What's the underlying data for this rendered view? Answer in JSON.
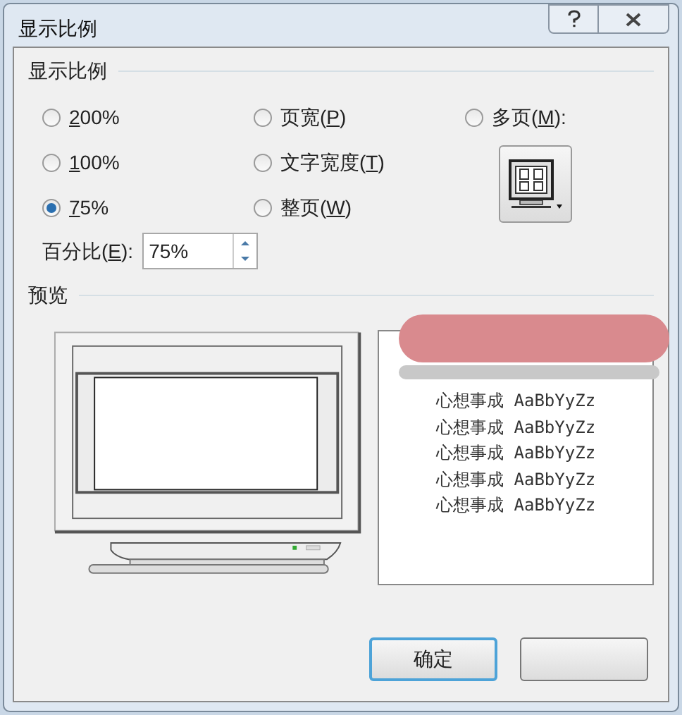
{
  "window": {
    "title": "显示比例"
  },
  "zoom_group": {
    "title": "显示比例",
    "options": [
      {
        "key": "2",
        "post": "00%",
        "selected": false
      },
      {
        "key": "1",
        "post": "00%",
        "selected": false
      },
      {
        "key": "7",
        "post": "5%",
        "selected": true
      },
      {
        "pre": "页宽(",
        "key": "P",
        "post": ")",
        "selected": false
      },
      {
        "pre": "文字宽度(",
        "key": "T",
        "post": ")",
        "selected": false
      },
      {
        "pre": "整页(",
        "key": "W",
        "post": ")",
        "selected": false
      },
      {
        "pre": "多页(",
        "key": "M",
        "post": "):",
        "selected": false
      }
    ],
    "percent": {
      "pre": "百分比(",
      "key": "E",
      "post": "):",
      "value": "75%"
    }
  },
  "preview": {
    "title": "预览",
    "sample_lines": [
      "心想事成 AaBbYyZz",
      "心想事成 AaBbYyZz",
      "心想事成 AaBbYyZz",
      "心想事成 AaBbYyZz",
      "心想事成 AaBbYyZz"
    ]
  },
  "buttons": [
    {
      "label": "确定",
      "default": true
    },
    {
      "default": false
    }
  ]
}
